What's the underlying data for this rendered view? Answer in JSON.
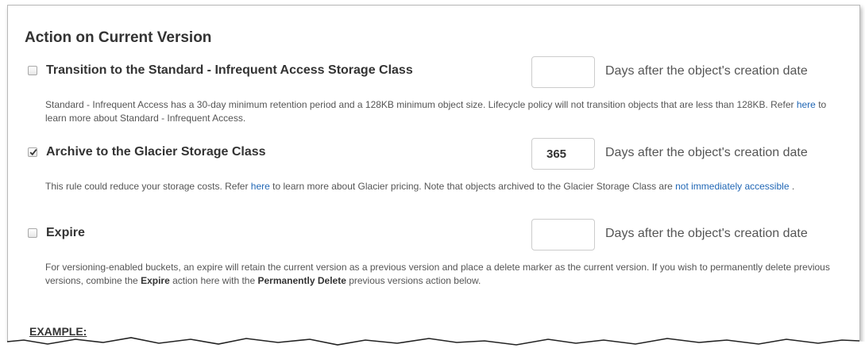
{
  "section_title": "Action on Current Version",
  "days_suffix": "Days after the object's creation date",
  "transition": {
    "checked": false,
    "label": "Transition to the Standard - Infrequent Access Storage Class",
    "days_value": "",
    "desc_1": "Standard - Infrequent Access has a 30-day minimum retention period and a 128KB minimum object size. Lifecycle policy will not transition objects that are less than 128KB. Refer ",
    "link": "here",
    "desc_2": " to learn more about Standard - Infrequent Access."
  },
  "archive": {
    "checked": true,
    "label": "Archive to the Glacier Storage Class",
    "days_value": "365",
    "desc_1": "This rule could reduce your storage costs. Refer ",
    "link_1": "here",
    "desc_2": " to learn more about Glacier pricing. Note that objects archived to the Glacier Storage Class are ",
    "link_2": "not immediately accessible",
    "desc_3": " ."
  },
  "expire": {
    "checked": false,
    "label": "Expire",
    "days_value": "",
    "desc_1": "For versioning-enabled buckets, an expire will retain the current version as a previous version and place a delete marker as the current version. If you wish to permanently delete previous versions, combine the ",
    "bold_1": "Expire",
    "desc_2": " action here with the ",
    "bold_2": "Permanently Delete",
    "desc_3": " previous versions action below."
  },
  "example_label": "EXAMPLE:",
  "colors": {
    "link": "#2167b5",
    "text": "#333333",
    "muted": "#555555",
    "border": "#cccccc"
  }
}
